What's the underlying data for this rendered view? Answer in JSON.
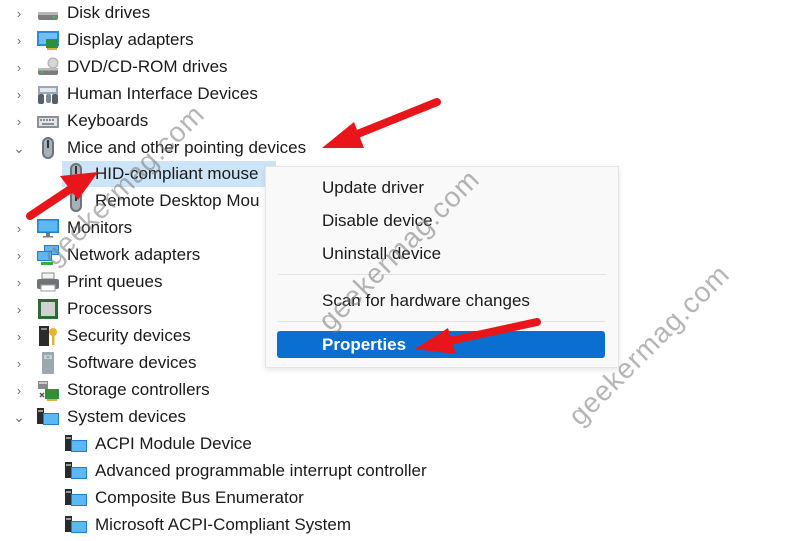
{
  "tree": {
    "items": [
      {
        "label": "Disk drives",
        "icon": "disk-drive-icon",
        "expanded": false
      },
      {
        "label": "Display adapters",
        "icon": "display-adapter-icon",
        "expanded": false
      },
      {
        "label": "DVD/CD-ROM drives",
        "icon": "dvd-drive-icon",
        "expanded": false
      },
      {
        "label": "Human Interface Devices",
        "icon": "hid-icon",
        "expanded": false
      },
      {
        "label": "Keyboards",
        "icon": "keyboard-icon",
        "expanded": false
      },
      {
        "label": "Mice and other pointing devices",
        "icon": "mouse-icon",
        "expanded": true,
        "children": [
          {
            "label": "HID-compliant mouse",
            "icon": "mouse-icon",
            "selected": true
          },
          {
            "label": "Remote Desktop Mouse Device",
            "visible_label": "Remote Desktop Mou",
            "icon": "mouse-icon"
          }
        ]
      },
      {
        "label": "Monitors",
        "icon": "monitor-icon",
        "expanded": false
      },
      {
        "label": "Network adapters",
        "icon": "network-adapter-icon",
        "expanded": false
      },
      {
        "label": "Print queues",
        "icon": "printer-icon",
        "expanded": false
      },
      {
        "label": "Processors",
        "icon": "processor-icon",
        "expanded": false
      },
      {
        "label": "Security devices",
        "icon": "security-device-icon",
        "expanded": false
      },
      {
        "label": "Software devices",
        "icon": "software-device-icon",
        "expanded": false
      },
      {
        "label": "Storage controllers",
        "icon": "storage-controller-icon",
        "expanded": false
      },
      {
        "label": "System devices",
        "icon": "system-device-icon",
        "expanded": true,
        "children": [
          {
            "label": "ACPI Module Device",
            "icon": "system-device-icon"
          },
          {
            "label": "Advanced programmable interrupt controller",
            "icon": "system-device-icon"
          },
          {
            "label": "Composite Bus Enumerator",
            "icon": "system-device-icon"
          },
          {
            "label": "Microsoft ACPI-Compliant System",
            "icon": "system-device-icon"
          }
        ]
      }
    ]
  },
  "context_menu": {
    "items": [
      {
        "label": "Update driver"
      },
      {
        "label": "Disable device"
      },
      {
        "label": "Uninstall device"
      },
      {
        "label": "Scan for hardware changes"
      },
      {
        "label": "Properties",
        "highlighted": true
      }
    ]
  },
  "watermark": "geekermag.com",
  "colors": {
    "selection": "#cce4f7",
    "menu_highlight": "#0a6fd0",
    "arrow": "#e8151b"
  }
}
